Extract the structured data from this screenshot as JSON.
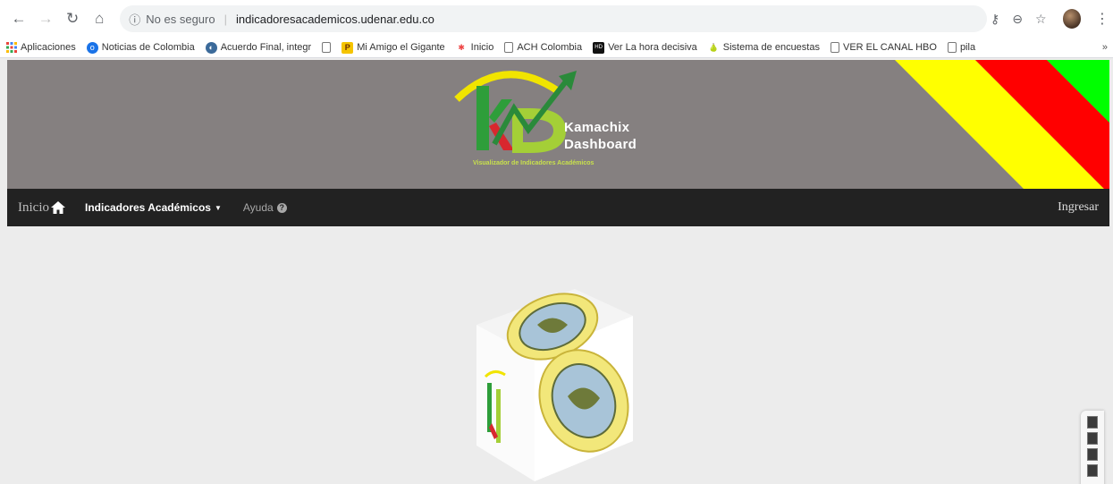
{
  "browser": {
    "url_security": "No es seguro",
    "url": "indicadoresacademicos.udenar.edu.co",
    "bookmarks": [
      {
        "label": "Aplicaciones",
        "icon": "apps-grid-icon"
      },
      {
        "label": "Noticias de Colombia",
        "icon": "news-icon"
      },
      {
        "label": "Acuerdo Final, integr",
        "icon": "globe-icon"
      },
      {
        "label": "",
        "icon": "page-icon"
      },
      {
        "label": "Mi Amigo el Gigante",
        "icon": "p-icon"
      },
      {
        "label": "Inicio",
        "icon": "joomla-icon"
      },
      {
        "label": "ACH Colombia",
        "icon": "page-icon"
      },
      {
        "label": "Ver La hora decisiva",
        "icon": "hd-icon"
      },
      {
        "label": "Sistema de encuestas",
        "icon": "survey-icon"
      },
      {
        "label": "VER EL CANAL HBO",
        "icon": "page-icon"
      },
      {
        "label": "pila",
        "icon": "page-icon"
      }
    ],
    "more": "»"
  },
  "site": {
    "logo_line1": "Kamachix",
    "logo_line2": "Dashboard",
    "logo_subtitle": "Visualizador de Indicadores Académicos",
    "nav": {
      "brand": "Inicio",
      "indicadores": "Indicadores Académicos",
      "ayuda": "Ayuda",
      "ingresar": "Ingresar"
    }
  },
  "colors": {
    "banner": "#858080",
    "navbar": "#222222",
    "stripe_yellow": "#ffff00",
    "stripe_red": "#ff0000",
    "stripe_green": "#00ff00"
  }
}
